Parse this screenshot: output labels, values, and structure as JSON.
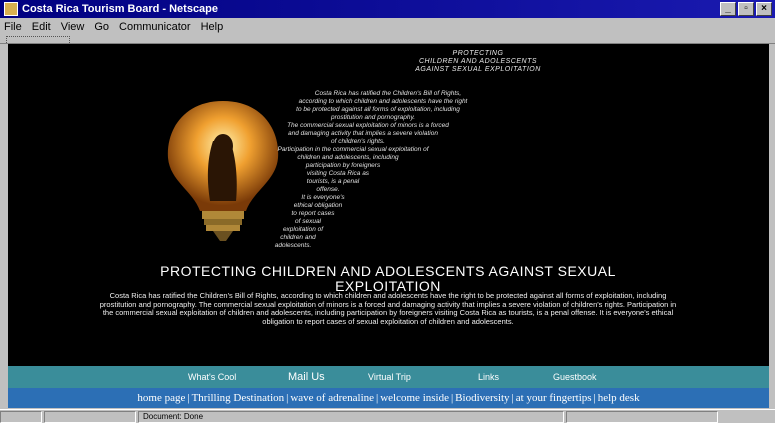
{
  "window": {
    "title": "Costa Rica Tourism Board - Netscape"
  },
  "menu": [
    "File",
    "Edit",
    "View",
    "Go",
    "Communicator",
    "Help"
  ],
  "page": {
    "small_heading": [
      "PROTECTING",
      "CHILDREN AND ADOLESCENTS",
      "AGAINST SEXUAL EXPLOITATION"
    ],
    "para_lines": [
      "Costa Rica has ratified the Children's Bill of Rights,",
      "according to which children and adolescents have the right",
      "to be protected against all forms of exploitation, including",
      "prostitution and pornography.",
      "The commercial sexual exploitation of minors is a forced",
      "and damaging activity that implies a severe violation",
      "of children's rights.",
      "Participation in the commercial sexual exploitation of",
      "children and adolescents, including",
      "participation by foreigners",
      "visiting Costa Rica as",
      "tourists, is a penal",
      "offense.",
      "It is everyone's",
      "ethical obligation",
      "to report cases",
      "of sexual",
      "exploitation of",
      "children and",
      "adolescents."
    ],
    "title_line1": "PROTECTING CHILDREN AND ADOLESCENTS AGAINST SEXUAL",
    "title_line2": "EXPLOITATION",
    "body": "Costa Rica has ratified the Children's Bill of Rights, according to which children and adolescents have the right to be protected against all forms of exploitation, including prostitution and pornography. The commercial sexual exploitation of minors is a forced and damaging activity that implies a severe violation of children's rights. Participation in the commercial sexual exploitation of children and adolescents, including participation by foreigners visiting Costa Rica as tourists, is a penal offense. It is everyone's ethical obligation to report cases of sexual exploitation of children and adolescents."
  },
  "nav_top": [
    "What's Cool",
    "Mail Us",
    "Virtual Trip",
    "Links",
    "Guestbook"
  ],
  "nav_bottom": [
    "home page",
    "Thrilling Destination",
    "wave of adrenaline",
    "welcome inside",
    "Biodiversity",
    "at your fingertips",
    "help desk"
  ],
  "status": {
    "text": "Document: Done"
  },
  "colors": {
    "nav_top_bg": "#3a8d9a",
    "nav_bottom_bg": "#2c6fb5",
    "page_bg": "#000000"
  }
}
